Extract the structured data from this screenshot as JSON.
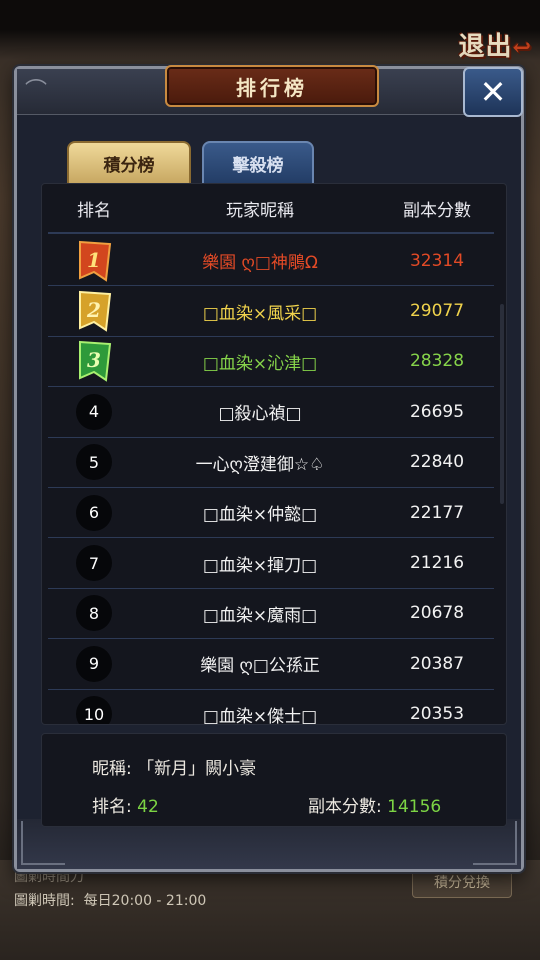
{
  "exit_label": "退出",
  "title": "排行榜",
  "close_label": "✕",
  "tabs": [
    {
      "label": "積分榜",
      "active": true
    },
    {
      "label": "擊殺榜",
      "active": false
    }
  ],
  "columns": {
    "rank": "排名",
    "name": "玩家昵稱",
    "score": "副本分數"
  },
  "rows": [
    {
      "rank": "1",
      "name": "樂園 ღ□神鵰Ω",
      "score": "32314",
      "color": "red"
    },
    {
      "rank": "2",
      "name": "□血染×風采□",
      "score": "29077",
      "color": "gold"
    },
    {
      "rank": "3",
      "name": "□血染×沁津□",
      "score": "28328",
      "color": "green"
    },
    {
      "rank": "4",
      "name": "□殺心禎□",
      "score": "26695",
      "color": "white"
    },
    {
      "rank": "5",
      "name": "一心ღ澄建御☆♤",
      "score": "22840",
      "color": "white"
    },
    {
      "rank": "6",
      "name": "□血染×仲懿□",
      "score": "22177",
      "color": "white"
    },
    {
      "rank": "7",
      "name": "□血染×揮刀□",
      "score": "21216",
      "color": "white"
    },
    {
      "rank": "8",
      "name": "□血染×魔雨□",
      "score": "20678",
      "color": "white"
    },
    {
      "rank": "9",
      "name": "樂園 ღ□公孫正",
      "score": "20387",
      "color": "white"
    },
    {
      "rank": "10",
      "name": "□血染×傑士□",
      "score": "20353",
      "color": "white"
    }
  ],
  "me": {
    "nickname_label": "昵稱:",
    "nickname": "「新月」闕小豪",
    "rank_label": "排名:",
    "rank": "42",
    "score_label": "副本分數:",
    "score": "14156"
  },
  "background": {
    "top_text": "圖剿時間刀",
    "time_label": "圖剿時間:",
    "time_value": "每日20:00 - 21:00",
    "exchange_button": "積分兌換"
  },
  "colors": {
    "red": "#e24a26",
    "gold": "#f0d34c",
    "green": "#86d44a",
    "accent_value": "#7cd444"
  }
}
